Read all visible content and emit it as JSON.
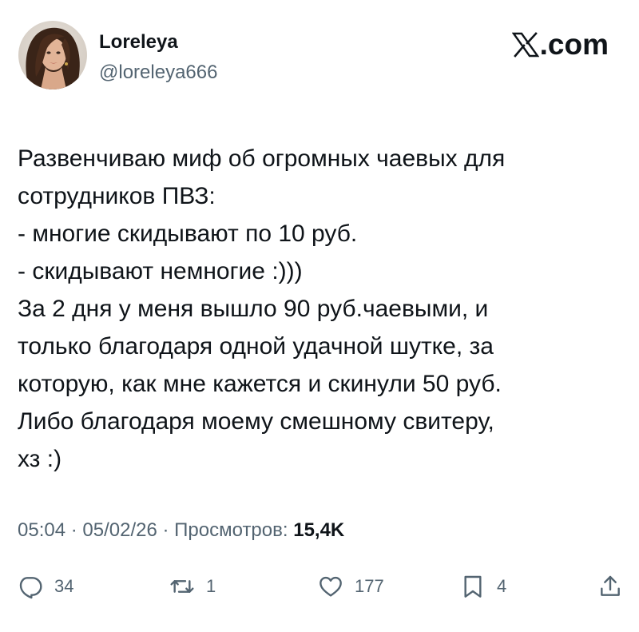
{
  "author": {
    "display_name": "Loreleya",
    "handle": "@loreleya666"
  },
  "brand": {
    "suffix": ".com"
  },
  "tweet": {
    "lines": [
      "Развенчиваю миф об огромных чаевых для",
      "сотрудников ПВЗ:",
      "- многие скидывают по 10 руб.",
      "- скидывают немногие :)))",
      "За 2 дня у меня вышло 90 руб.чаевыми, и",
      "только благодаря одной удачной шутке, за",
      "которую, как мне кажется и скинули 50 руб.",
      "Либо благодаря моему смешному свитеру,",
      "хз :)"
    ]
  },
  "meta": {
    "time": "05:04",
    "date": "05/02/26",
    "views_label": "Просмотров:",
    "views_count": "15,4K"
  },
  "actions": {
    "replies": "34",
    "reposts": "1",
    "likes": "177",
    "bookmarks": "4"
  }
}
